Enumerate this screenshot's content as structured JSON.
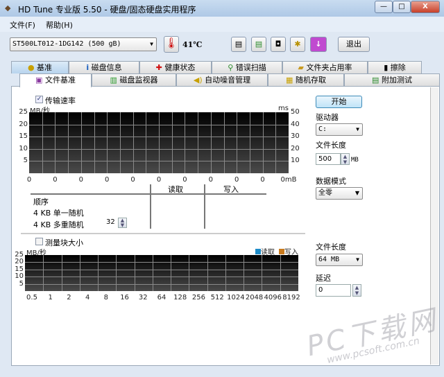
{
  "window": {
    "title": "HD Tune 专业版 5.50 - 硬盘/固态硬盘实用程序",
    "minimize": "—",
    "maximize": "□",
    "close": "X"
  },
  "menu": [
    "文件(F)",
    "帮助(H)"
  ],
  "toolbar": {
    "drive": "ST500LT012-1DG142 (500 gB)",
    "temperature": "41℃",
    "exit": "退出"
  },
  "tabs_row1": [
    {
      "icon": "bulb",
      "label": "基准"
    },
    {
      "icon": "info",
      "label": "磁盘信息"
    },
    {
      "icon": "cross",
      "label": "健康状态"
    },
    {
      "icon": "magnifier",
      "label": "错误扫描"
    },
    {
      "icon": "folder",
      "label": "文件夹占用率"
    },
    {
      "icon": "trash",
      "label": "擦除"
    }
  ],
  "tabs_row2": [
    {
      "icon": "file-benchmark",
      "label": "文件基准"
    },
    {
      "icon": "monitor",
      "label": "磁盘监视器"
    },
    {
      "icon": "speaker",
      "label": "自动噪音管理"
    },
    {
      "icon": "random",
      "label": "随机存取"
    },
    {
      "icon": "extra",
      "label": "附加测试"
    }
  ],
  "transfer": {
    "checkbox": "传输速率",
    "checked": true,
    "yunit": "MB/秒",
    "y2unit": "ms",
    "yticks": [
      "25",
      "20",
      "15",
      "10",
      "5"
    ],
    "y2ticks": [
      "50",
      "40",
      "30",
      "20",
      "10"
    ],
    "xticks": [
      "0",
      "0",
      "0",
      "0",
      "0",
      "0",
      "0",
      "0",
      "0",
      "0",
      "0mB"
    ]
  },
  "results": {
    "read": "读取",
    "write": "写入",
    "rows": [
      "顺序",
      "4 KB 单一随机",
      "4 KB 多重随机"
    ],
    "queue_depth": "32"
  },
  "block": {
    "checkbox": "测量块大小",
    "checked": false,
    "yunit": "MB/秒",
    "legend_read": "读取",
    "legend_write": "写入",
    "read_color": "#1e8cc8",
    "write_color": "#c87a1e",
    "yticks": [
      "25",
      "20",
      "15",
      "10",
      "5"
    ],
    "xticks": [
      "0.5",
      "1",
      "2",
      "4",
      "8",
      "16",
      "32",
      "64",
      "128",
      "256",
      "512",
      "1024",
      "2048",
      "4096",
      "8192"
    ]
  },
  "right": {
    "start": "开始",
    "drive_label": "驱动器",
    "drive": "C:",
    "filesize_label": "文件长度",
    "filesize": "500",
    "filesize_unit": "MB",
    "pattern_label": "数据模式",
    "pattern": "全零",
    "block_filesize_label": "文件长度",
    "block_filesize": "64 MB",
    "delay_label": "延迟",
    "delay": "0"
  },
  "watermark": {
    "text": "PC下载网",
    "url": "www.pcsoft.com.cn"
  }
}
